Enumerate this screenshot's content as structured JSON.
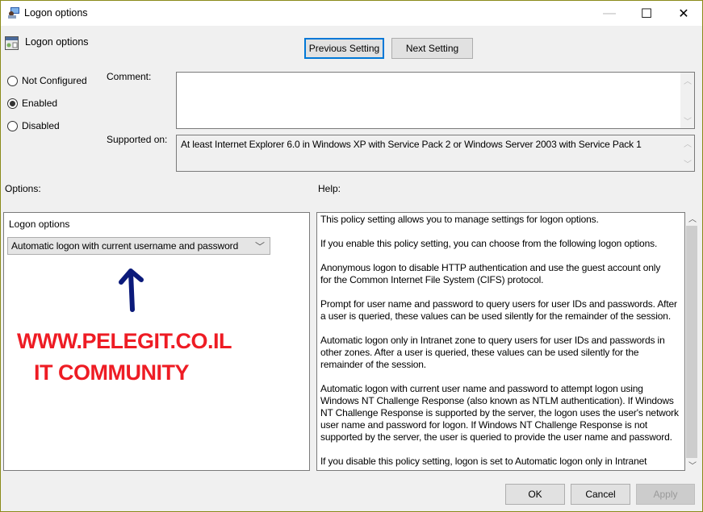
{
  "window": {
    "title": "Logon options",
    "controls": {
      "minimize": "—",
      "maximize": "☐",
      "close": "✕"
    }
  },
  "header": {
    "policy_name": "Logon options",
    "previous_label": "Previous Setting",
    "next_label": "Next Setting"
  },
  "state": {
    "options": [
      {
        "label": "Not Configured",
        "checked": false
      },
      {
        "label": "Enabled",
        "checked": true
      },
      {
        "label": "Disabled",
        "checked": false
      }
    ]
  },
  "comment": {
    "label": "Comment:",
    "value": ""
  },
  "supported": {
    "label": "Supported on:",
    "value": "At least Internet Explorer 6.0 in Windows XP with Service Pack 2 or Windows Server 2003 with Service Pack 1"
  },
  "options_label": "Options:",
  "help_label": "Help:",
  "options_panel": {
    "label": "Logon options",
    "selected": "Automatic logon with current username and password"
  },
  "watermark": {
    "line1": "WWW.PELEGIT.CO.IL",
    "line2": "IT COMMUNITY",
    "arrow_color": "#0b1a7a",
    "text_color": "#ee1c24"
  },
  "help": [
    [
      "This policy setting allows you to manage settings for logon options."
    ],
    [
      "If you enable this policy setting, you can choose from the following logon options."
    ],
    [
      "Anonymous logon to disable HTTP authentication and use the guest account only",
      "for the Common Internet File System (CIFS) protocol."
    ],
    [
      "Prompt for user name and password to query users for user IDs and passwords. After",
      "a user is queried, these values can be used silently for the remainder of the session."
    ],
    [
      "Automatic logon only in Intranet zone to query users for user IDs and passwords in",
      "other zones. After a user is queried, these values can be used silently for the",
      "remainder of the session."
    ],
    [
      "Automatic logon with current user name and password to attempt logon using",
      "Windows NT Challenge Response (also known as NTLM authentication). If Windows",
      "NT Challenge Response is supported by the server, the logon uses the user's network",
      "user name and password for logon. If Windows NT Challenge Response is not",
      "supported by the server, the user is queried to provide the user name and password."
    ],
    [
      "If you disable this policy setting, logon is set to Automatic logon only in Intranet"
    ]
  ],
  "footer": {
    "ok": "OK",
    "cancel": "Cancel",
    "apply": "Apply"
  }
}
